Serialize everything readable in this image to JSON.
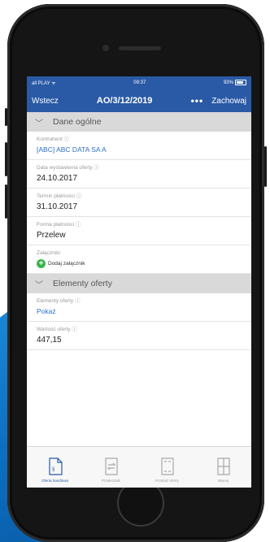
{
  "status_bar": {
    "carrier": "all PLAY ᯤ",
    "time": "09:37",
    "battery": "93%"
  },
  "navbar": {
    "back_label": "Wstecz",
    "title": "AO/3/12/2019",
    "more_label": "•••",
    "save_label": "Zachowaj"
  },
  "section_general": {
    "title": "Dane ogólne",
    "fields": [
      {
        "label": "Kontrahent ⓘ",
        "value": "[ABC] ABC DATA SA A"
      },
      {
        "label": "Data wystawienia oferty ⓘ",
        "value": "24.10.2017"
      },
      {
        "label": "Termin płatności ⓘ",
        "value": "31.10.2017"
      },
      {
        "label": "Forma płatności ⓘ",
        "value": "Przelew"
      }
    ],
    "attachments": {
      "label": "Załączniki",
      "add_label": "Dodaj załącznik"
    }
  },
  "section_items": {
    "title": "Elementy oferty",
    "fields": [
      {
        "label": "Elementy oferty ⓘ",
        "value": "Pokaż"
      },
      {
        "label": "Wartość oferty ⓘ",
        "value": "447,15"
      }
    ]
  },
  "tabbar": {
    "tabs": [
      {
        "label": "Oferta handlowa",
        "icon": "document-icon",
        "active": true
      },
      {
        "label": "Przekształć",
        "icon": "transform-icon",
        "active": false
      },
      {
        "label": "Przekaż oferty",
        "icon": "forward-icon",
        "active": false
      },
      {
        "label": "Więcej",
        "icon": "more-icon",
        "active": false
      }
    ]
  },
  "colors": {
    "header_bg": "#2a5aa6",
    "link": "#2a6fd0",
    "add_icon": "#3bb34a",
    "section_bg": "#d9d9d9"
  }
}
